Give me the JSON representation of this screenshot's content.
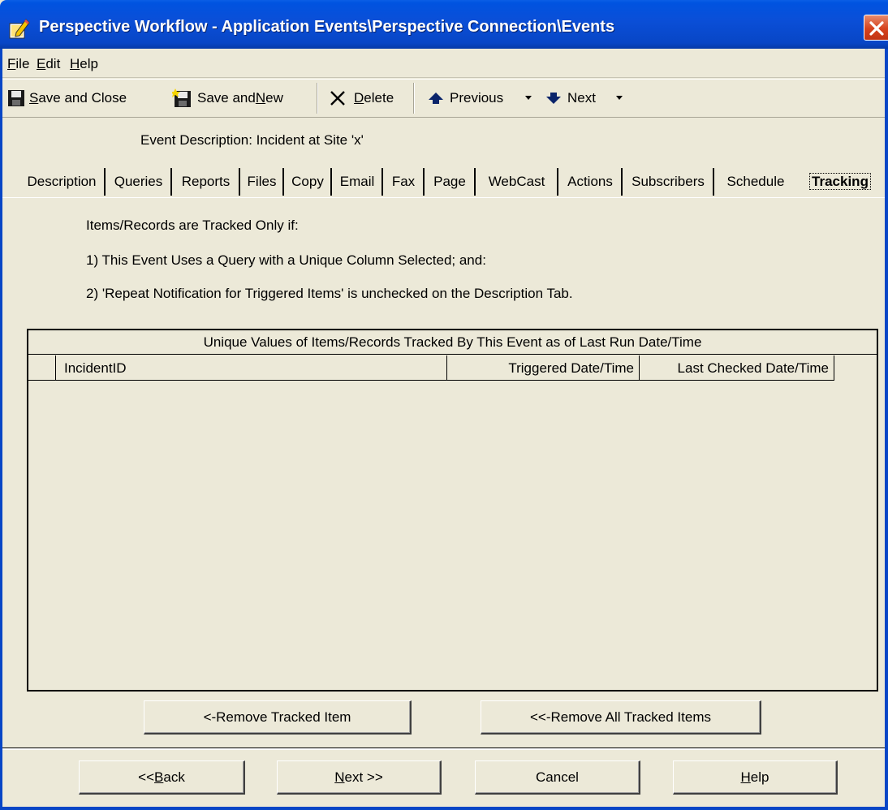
{
  "window": {
    "title": "Perspective Workflow - Application Events\\Perspective Connection\\Events",
    "icon": "pencil-edit-icon",
    "close_icon": "close-icon"
  },
  "menu": {
    "file": {
      "pre": "",
      "key": "F",
      "post": "ile"
    },
    "edit": {
      "pre": "",
      "key": "E",
      "post": "dit"
    },
    "help": {
      "pre": "",
      "key": "H",
      "post": "elp"
    }
  },
  "toolbar": {
    "save_close": {
      "pre": "",
      "key": "S",
      "post": "ave and Close",
      "icon": "floppy-disk-icon"
    },
    "save_new": {
      "pre": "Save and ",
      "key": "N",
      "post": "ew",
      "icon": "floppy-disk-new-icon"
    },
    "delete": {
      "pre": "",
      "key": "D",
      "post": "elete",
      "icon": "x-delete-icon"
    },
    "previous": {
      "label": "Previous",
      "icon": "arrow-up-icon"
    },
    "next": {
      "label": "Next",
      "icon": "arrow-down-icon"
    },
    "dropdown_icon": "dropdown-arrow-icon"
  },
  "event_description": "Event Description:  Incident at Site 'x'",
  "tabs": [
    {
      "label": "Description"
    },
    {
      "label": "Queries"
    },
    {
      "label": "Reports"
    },
    {
      "label": "Files"
    },
    {
      "label": "Copy"
    },
    {
      "label": "Email"
    },
    {
      "label": "Fax"
    },
    {
      "label": "Page"
    },
    {
      "label": "WebCast"
    },
    {
      "label": "Actions"
    },
    {
      "label": "Subscribers"
    },
    {
      "label": "Schedule"
    },
    {
      "label": "Tracking",
      "active": true
    }
  ],
  "info_lines": [
    "Items/Records are Tracked Only if:",
    "1) This Event Uses a Query with a Unique Column Selected; and:",
    "2) 'Repeat Notification for Triggered Items' is unchecked on the Description Tab."
  ],
  "grid": {
    "title": "Unique Values of Items/Records Tracked By This Event as of Last Run Date/Time",
    "columns": [
      "IncidentID",
      "Triggered Date/Time",
      "Last Checked Date/Time"
    ],
    "rows": []
  },
  "buttons": {
    "remove_tracked": "<-Remove Tracked Item",
    "remove_all": "<<-Remove All Tracked Items",
    "back": {
      "pre": "<< ",
      "key": "B",
      "post": "ack"
    },
    "next": {
      "pre": "",
      "key": "N",
      "post": "ext >>"
    },
    "cancel": "Cancel",
    "help": {
      "pre": "",
      "key": "H",
      "post": "elp"
    }
  }
}
